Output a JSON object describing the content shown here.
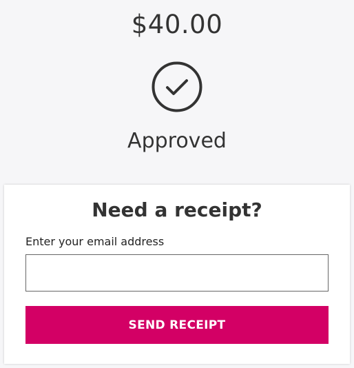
{
  "payment": {
    "amount": "$40.00",
    "status": "Approved",
    "status_icon": "check-circle-icon"
  },
  "receipt": {
    "title": "Need a receipt?",
    "email_label": "Enter your email address",
    "email_value": "",
    "email_placeholder": "",
    "send_button_label": "SEND RECEIPT"
  },
  "colors": {
    "accent": "#d30065",
    "background": "#f6f6f8",
    "text": "#333333"
  }
}
